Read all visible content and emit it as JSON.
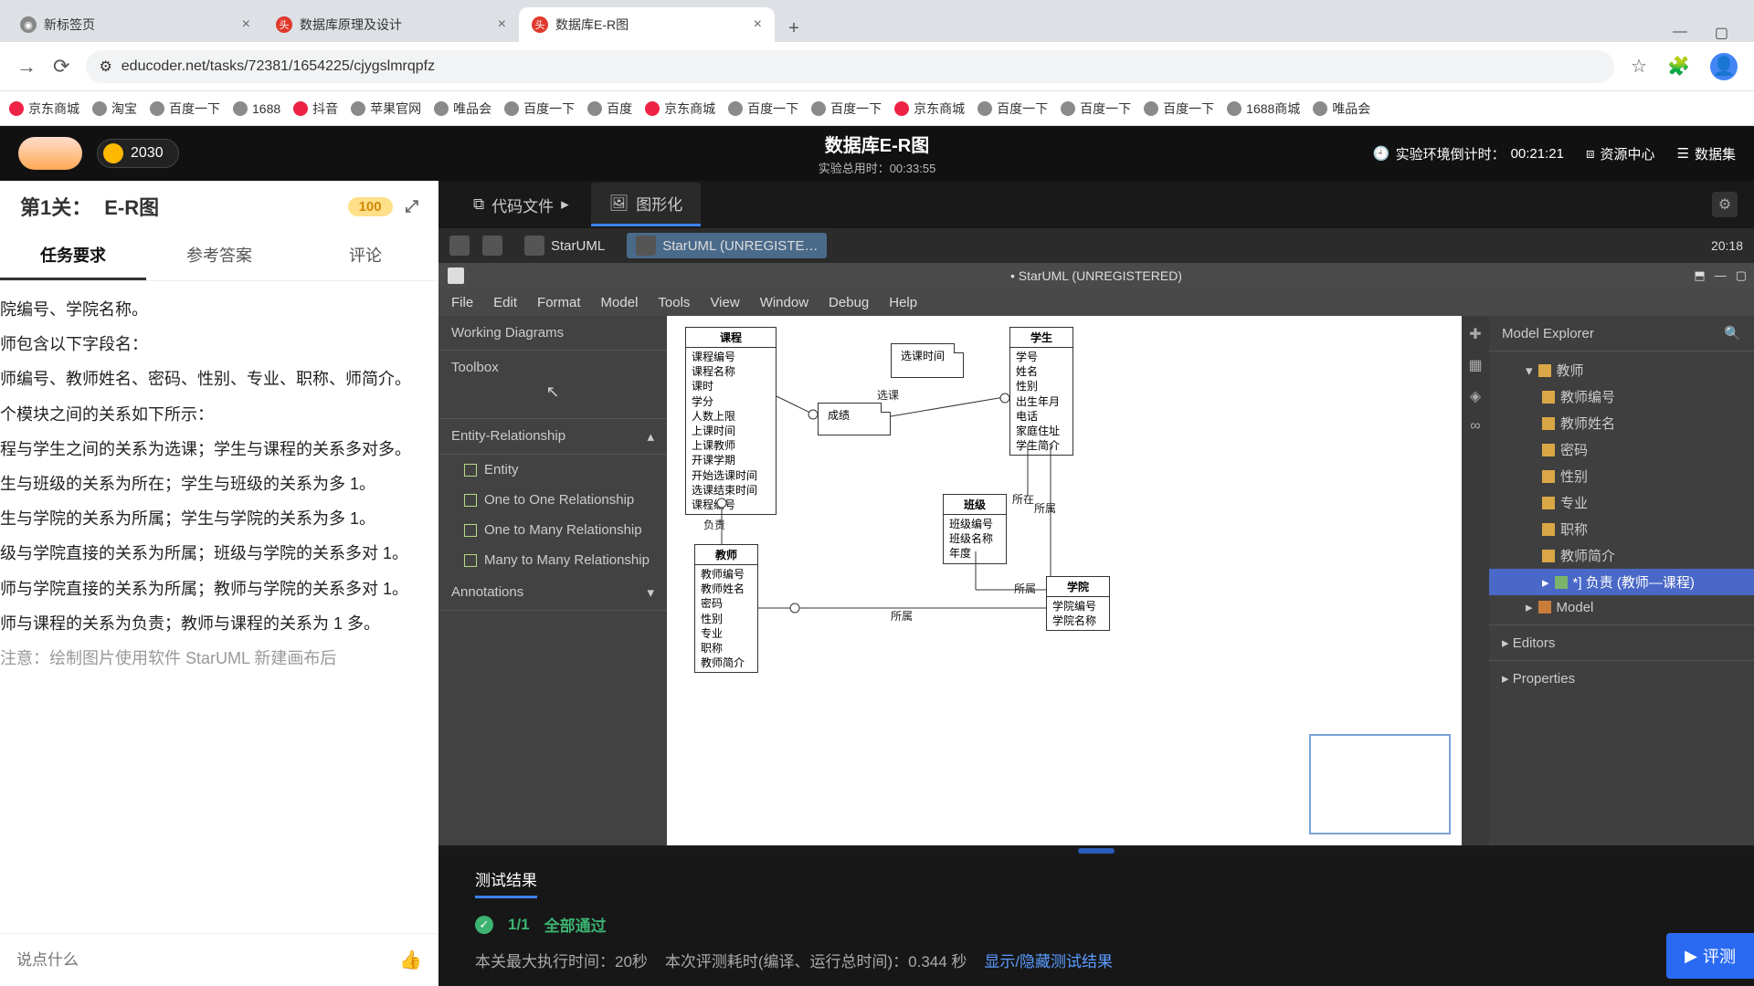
{
  "browser": {
    "tabs": [
      {
        "title": "新标签页",
        "favicon": "fav-gray"
      },
      {
        "title": "数据库原理及设计",
        "favicon": "fav-red"
      },
      {
        "title": "数据库E-R图",
        "favicon": "fav-red",
        "active": true
      }
    ],
    "url": "educoder.net/tasks/72381/1654225/cjygslmrqpfz",
    "bookmarks": [
      "京东商城",
      "淘宝",
      "百度一下",
      "1688",
      "抖音",
      "苹果官网",
      "唯品会",
      "百度一下",
      "百度",
      "京东商城",
      "百度一下",
      "百度一下",
      "京东商城",
      "百度一下",
      "百度一下",
      "百度一下",
      "1688商城",
      "唯品会"
    ]
  },
  "header": {
    "coins": "2030",
    "title": "数据库E-R图",
    "subtitle_label": "实验总用时：",
    "subtitle_time": "00:33:55",
    "countdown_label": "实验环境倒计时：",
    "countdown_time": "00:21:21",
    "res_center": "资源中心",
    "dataset": "数据集"
  },
  "sidebar": {
    "level_prefix": "第1关：",
    "level_title": "E-R图",
    "score_badge": "100",
    "tabs": [
      "任务要求",
      "参考答案",
      "评论"
    ],
    "paragraphs": [
      "院编号、学院名称。",
      "师包含以下字段名：",
      "师编号、教师姓名、密码、性别、专业、职称、师简介。",
      "个模块之间的关系如下所示：",
      "程与学生之间的关系为选课；学生与课程的关系多对多。",
      "生与班级的关系为所在；学生与班级的关系为多 1。",
      "生与学院的关系为所属；学生与学院的关系为多 1。",
      "级与学院直接的关系为所属；班级与学院的关系多对 1。",
      "师与学院直接的关系为所属；教师与学院的关系多对 1。",
      "师与课程的关系为负责；教师与课程的关系为 1 多。",
      "注意：绘制图片使用软件 StarUML 新建画布后"
    ],
    "input_placeholder": "说点什么"
  },
  "workarea": {
    "tabs": {
      "code": "代码文件",
      "graph": "图形化"
    },
    "remote": {
      "app": "StarUML",
      "tasktitle": "StarUML (UNREGISTE…",
      "clock": "20:18"
    },
    "uml": {
      "wintitle": "• StarUML (UNREGISTERED)",
      "menus": [
        "File",
        "Edit",
        "Format",
        "Model",
        "Tools",
        "View",
        "Window",
        "Debug",
        "Help"
      ],
      "left": {
        "working": "Working Diagrams",
        "toolbox": "Toolbox",
        "er_group": "Entity-Relationship",
        "tools": [
          "Entity",
          "One to One Relationship",
          "One to Many Relationship",
          "Many to Many Relationship"
        ],
        "annotations": "Annotations"
      },
      "right": {
        "explorer": "Model Explorer",
        "tree_root": "教师",
        "tree_children": [
          "教师编号",
          "教师姓名",
          "密码",
          "性别",
          "专业",
          "职称",
          "教师简介"
        ],
        "tree_sel": "*] 负责 (教师—课程)",
        "tree_model": "Model",
        "editors": "Editors",
        "properties": "Properties"
      },
      "entities": {
        "course": {
          "name": "课程",
          "attrs": [
            "课程编号",
            "课程名称",
            "课时",
            "学分",
            "人数上限",
            "上课时间",
            "上课教师",
            "开课学期",
            "开始选课时间",
            "选课结束时间",
            "课程编号"
          ]
        },
        "student": {
          "name": "学生",
          "attrs": [
            "学号",
            "姓名",
            "性别",
            "出生年月",
            "电话",
            "家庭住址",
            "学生简介"
          ]
        },
        "class": {
          "name": "班级",
          "attrs": [
            "班级编号",
            "班级名称",
            "年度"
          ]
        },
        "college": {
          "name": "学院",
          "attrs": [
            "学院编号",
            "学院名称"
          ]
        },
        "teacher": {
          "name": "教师",
          "attrs": [
            "教师编号",
            "教师姓名",
            "密码",
            "性别",
            "专业",
            "职称",
            "教师简介"
          ]
        }
      },
      "relations": {
        "sel_time": "选课时间",
        "score": "成绩",
        "select": "选课",
        "belong": "所属",
        "locate": "所在",
        "duty": "负责"
      }
    }
  },
  "results": {
    "tab": "测试结果",
    "count": "1/1",
    "pass": "全部通过",
    "line2_a": "本关最大执行时间：20秒",
    "line2_b": "本次评测耗时(编译、运行总时间)：0.344 秒",
    "link": "显示/隐藏测试结果",
    "eval_btn": "评测"
  }
}
